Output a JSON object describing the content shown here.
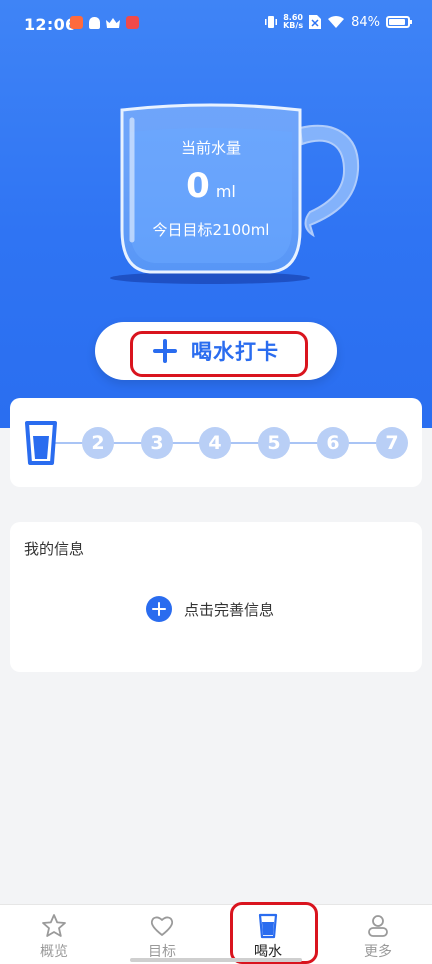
{
  "status_bar": {
    "time": "12:06",
    "net_speed_value": "8.60",
    "net_speed_unit": "KB/s",
    "battery": "84%"
  },
  "hero": {
    "current_label": "当前水量",
    "current_amount": "0",
    "current_unit": "ml",
    "goal_text": "今日目标2100ml"
  },
  "checkin_button": {
    "label": "喝水打卡"
  },
  "steps": {
    "items": [
      "2",
      "3",
      "4",
      "5",
      "6",
      "7"
    ]
  },
  "info_card": {
    "title": "我的信息",
    "add_label": "点击完善信息"
  },
  "tabbar": {
    "tabs": [
      {
        "label": "概览",
        "icon": "star-icon"
      },
      {
        "label": "目标",
        "icon": "heart-icon"
      },
      {
        "label": "喝水",
        "icon": "water-cup-icon",
        "active": true
      },
      {
        "label": "更多",
        "icon": "person-icon"
      }
    ]
  },
  "colors": {
    "primary": "#2a6cef",
    "hero_bg": "#3179f4",
    "highlight": "#d9141e",
    "step_inactive": "#b9cff6"
  }
}
